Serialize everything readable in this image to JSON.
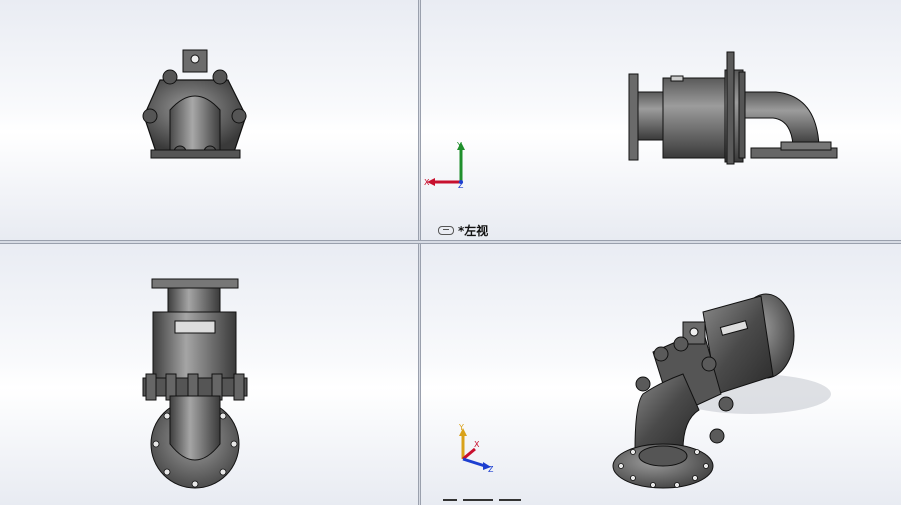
{
  "viewports": {
    "top_right": {
      "view_label": "*左视"
    }
  },
  "triads": {
    "top_right": {
      "x": "X",
      "y": "Y",
      "z": "Z"
    },
    "bottom_right": {
      "x": "X",
      "y": "Y",
      "z": "Z"
    }
  },
  "colors": {
    "part_dark": "#3a3a3a",
    "part_mid": "#6c6c6c",
    "part_light": "#9a9a9a",
    "axis_x": "#c8102e",
    "axis_y": "#1f8f2c",
    "axis_z": "#1d3fd0",
    "axis_yellow": "#d9a21b"
  }
}
